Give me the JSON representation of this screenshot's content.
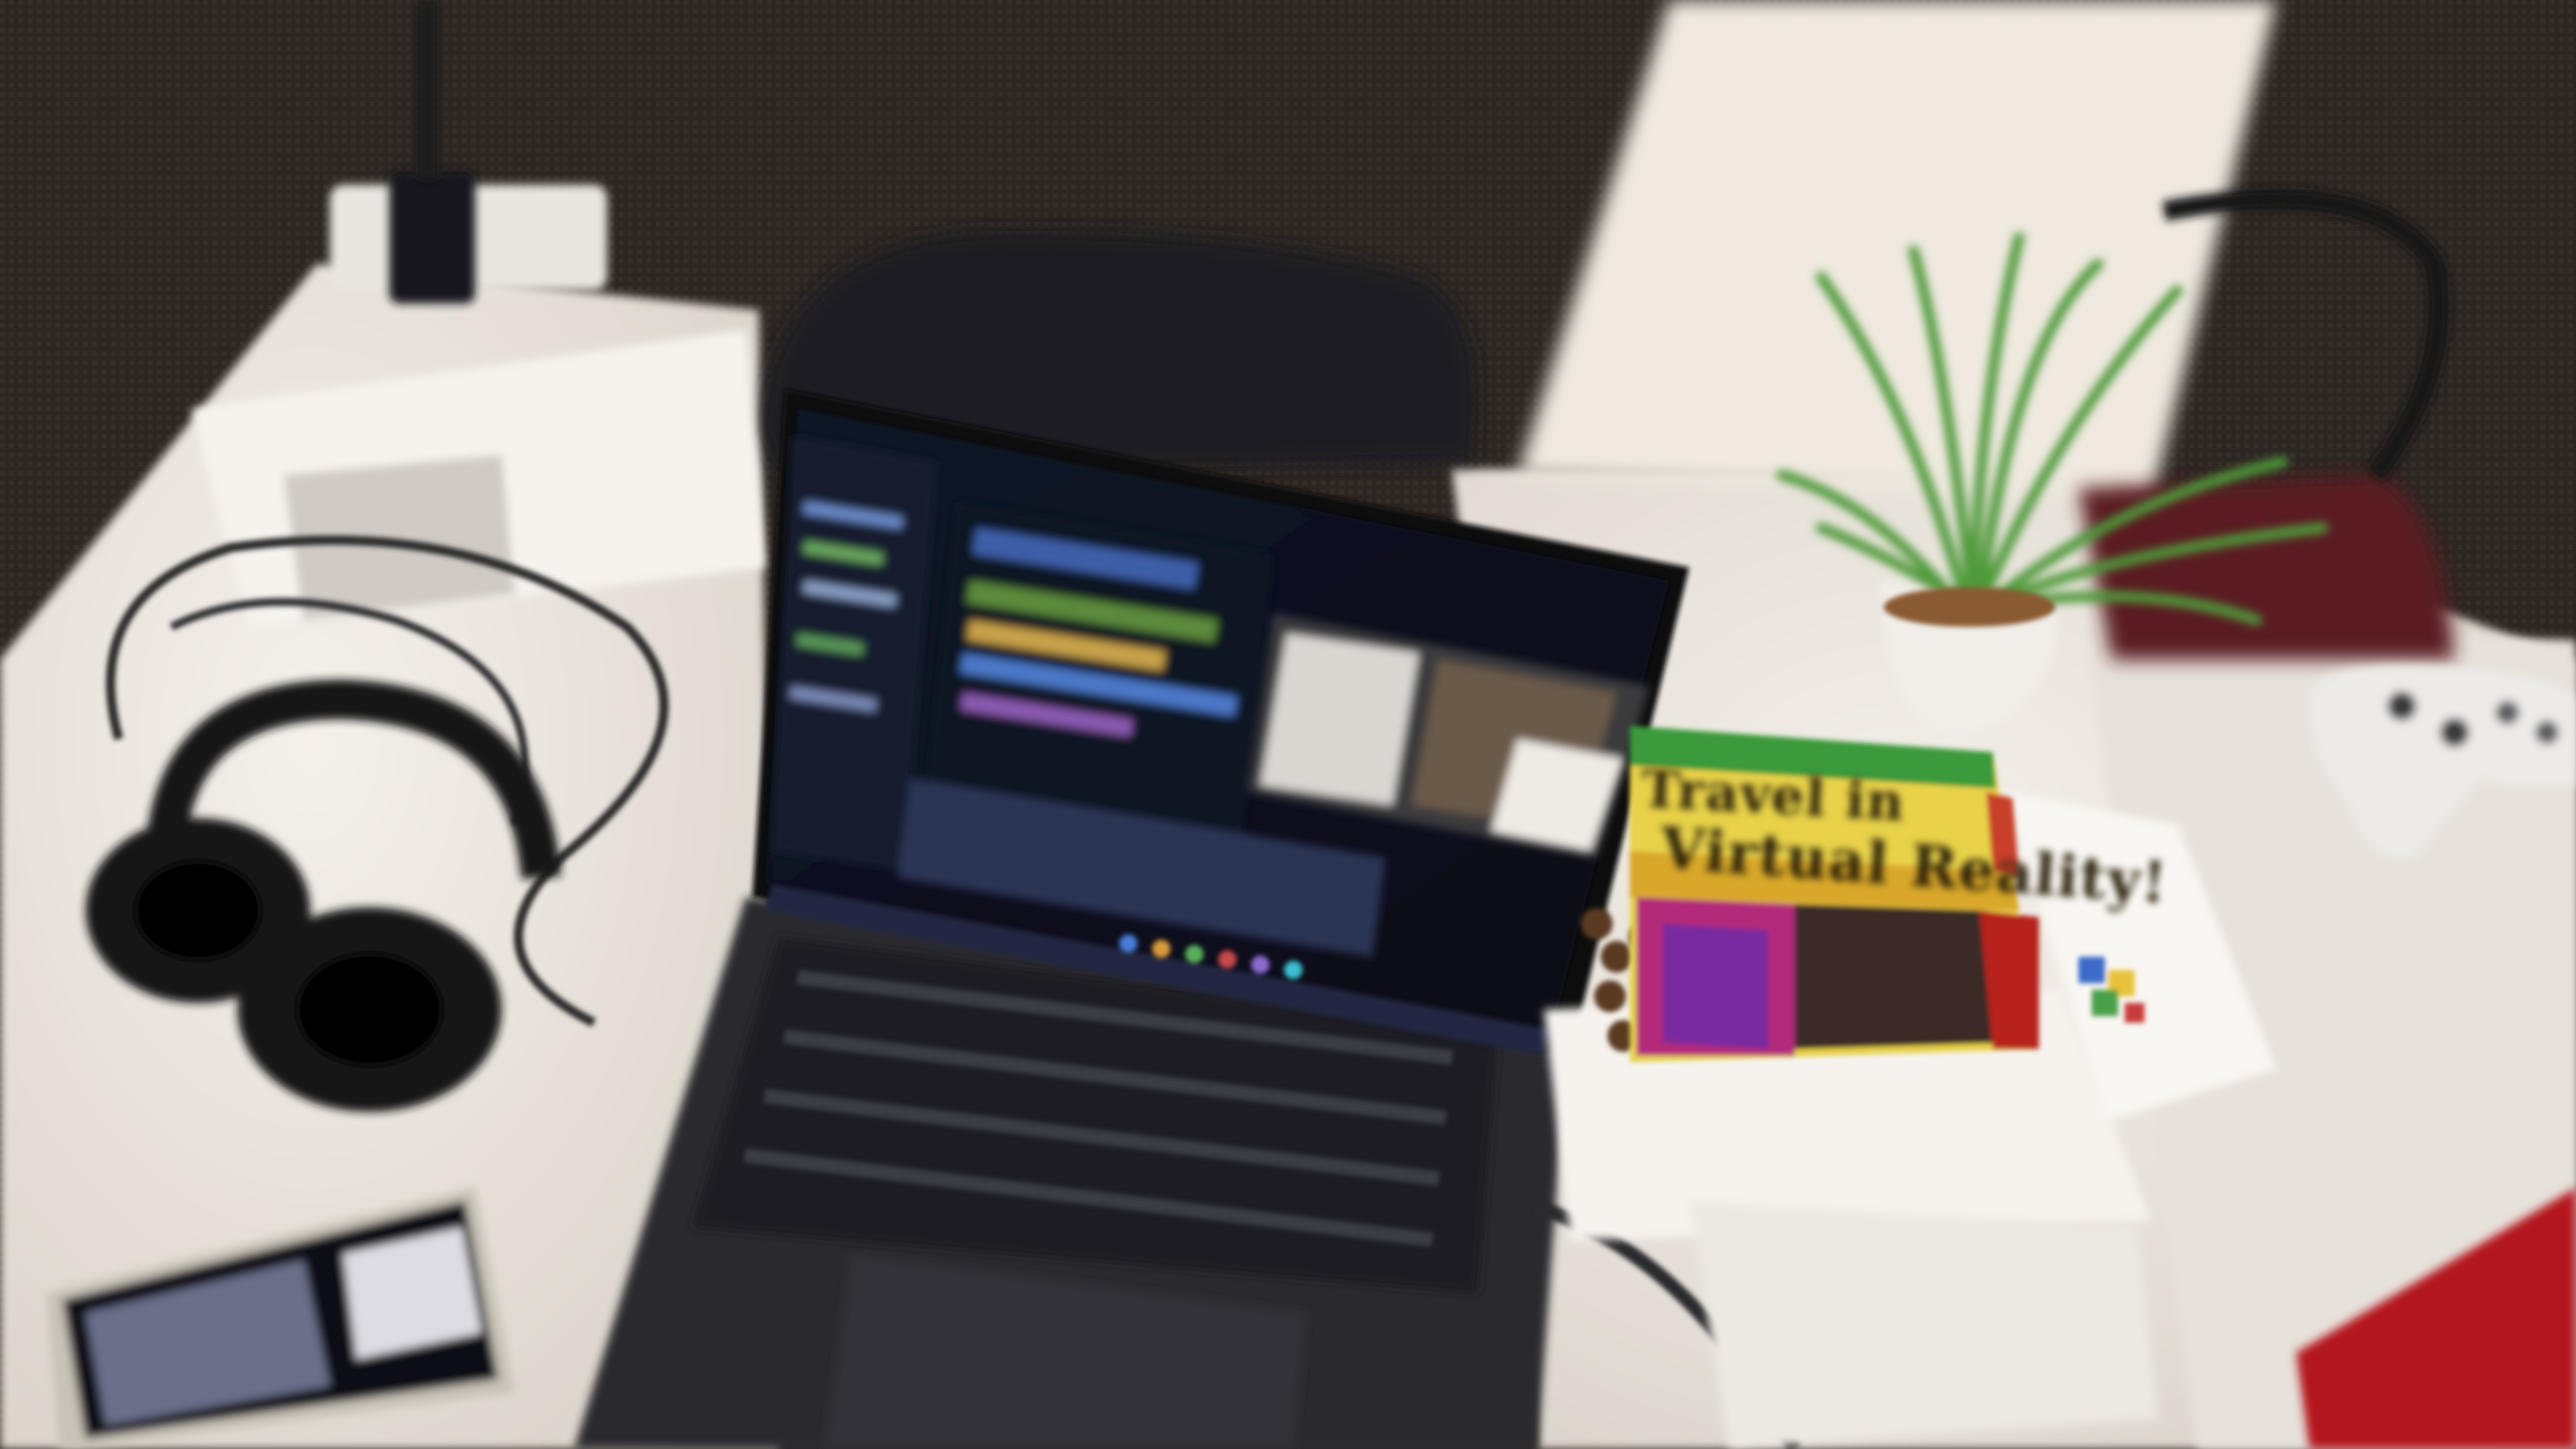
{
  "flyer": {
    "title_line1": "Travel in",
    "title_line2": "Virtual Reality!"
  },
  "colors": {
    "floor": "#2c2622",
    "desk": "#ebe6e0",
    "laptop_body": "#2a2a2e",
    "screen_bg": "#0d1220",
    "flyer_green": "#3a9a3a",
    "flyer_yellow": "#e8d24a",
    "flyer_red": "#b8241e",
    "plant_green": "#4f9a3a",
    "red_notebook": "#b3141c"
  },
  "objects": [
    "laptop",
    "headphones",
    "smartphone",
    "potted-plant",
    "game-controller",
    "usb-charger",
    "vr-flyer",
    "red-notebook",
    "papers"
  ]
}
